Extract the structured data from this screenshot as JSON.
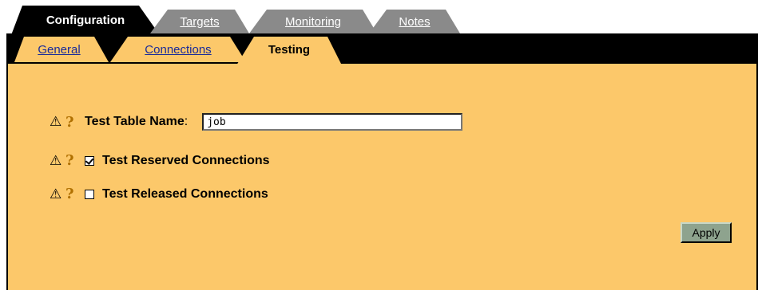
{
  "top_tabs": [
    {
      "label": "Configuration",
      "active": true
    },
    {
      "label": "Targets",
      "active": false
    },
    {
      "label": "Monitoring",
      "active": false
    },
    {
      "label": "Notes",
      "active": false
    }
  ],
  "sub_tabs": [
    {
      "label": "General",
      "active": false
    },
    {
      "label": "Connections",
      "active": false
    },
    {
      "label": "Testing",
      "active": true
    }
  ],
  "form": {
    "test_table_name": {
      "label": "Test Table Name",
      "colon": ":",
      "value": "job"
    },
    "test_reserved": {
      "label": "Test Reserved Connections",
      "checked": true
    },
    "test_released": {
      "label": "Test Released Connections",
      "checked": false
    }
  },
  "icons": {
    "warning": "warning-icon",
    "help": "help-icon"
  },
  "apply_label": "Apply",
  "colors": {
    "panel": "#fcc86a",
    "band": "#000000",
    "inactive_top_tab": "#8a8a8a",
    "active_tab": "#fcc86a",
    "link": "#1a2a9a",
    "apply_button": "#8ea38e"
  }
}
